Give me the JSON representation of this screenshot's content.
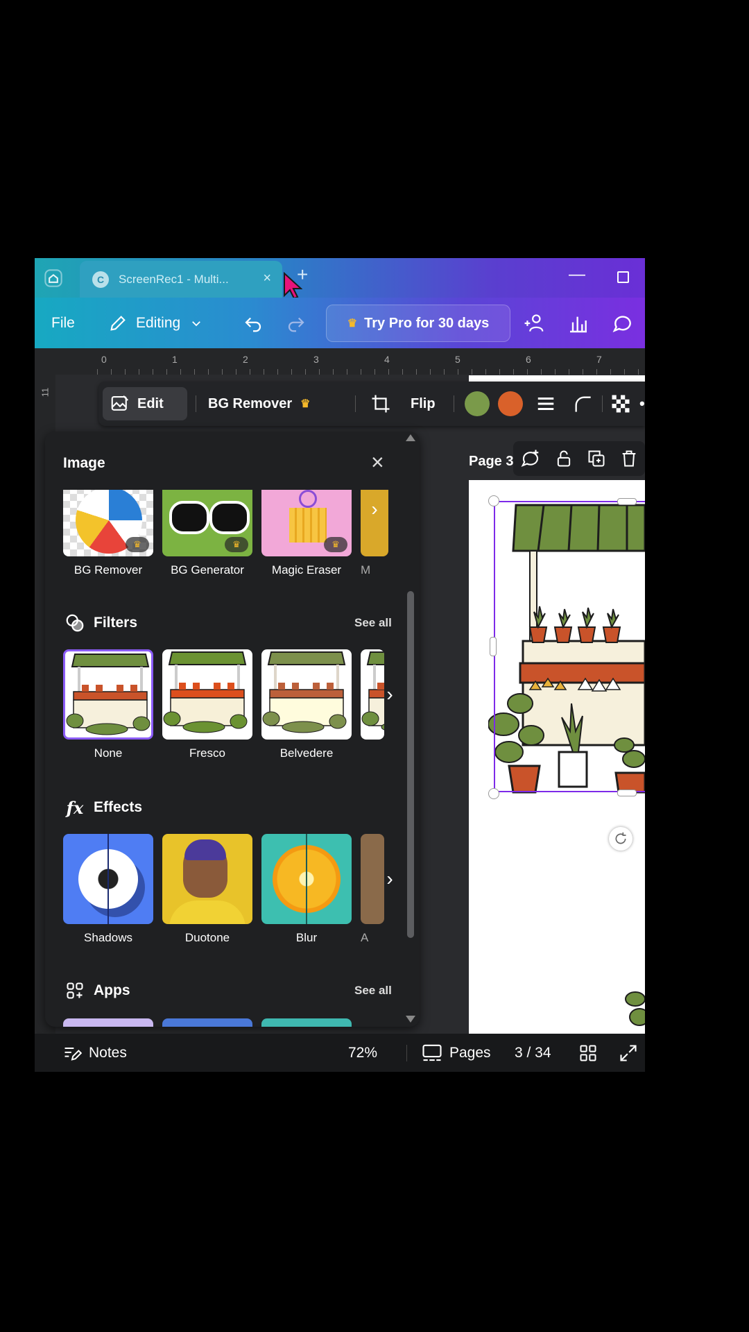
{
  "titlebar": {
    "tab_title": "ScreenRec1 - Multi...",
    "tab_favicon": "C",
    "tab_close": "×",
    "new_tab": "+",
    "minimize": "—"
  },
  "menubar": {
    "file": "File",
    "editing": "Editing",
    "try_pro": "Try Pro for 30 days"
  },
  "ruler": {
    "marks": [
      "0",
      "1",
      "2",
      "3",
      "4",
      "5",
      "6",
      "7"
    ],
    "vertical_mark": "11"
  },
  "toolbar": {
    "edit": "Edit",
    "bg_remover": "BG Remover",
    "flip": "Flip",
    "colors": [
      "#7a9a4a",
      "#d9612a"
    ]
  },
  "canvas": {
    "page_label": "Page 3"
  },
  "panel": {
    "title": "Image",
    "close": "×",
    "tools": [
      "BG Remover",
      "BG Generator",
      "Magic Eraser",
      "M"
    ],
    "filters": {
      "heading": "Filters",
      "see_all": "See all",
      "items": [
        "None",
        "Fresco",
        "Belvedere"
      ]
    },
    "effects": {
      "heading": "Effects",
      "items": [
        "Shadows",
        "Duotone",
        "Blur",
        "A"
      ]
    },
    "apps": {
      "heading": "Apps",
      "see_all": "See all"
    }
  },
  "bottombar": {
    "notes": "Notes",
    "zoom": "72%",
    "pages": "Pages",
    "page_count": "3 / 34"
  }
}
